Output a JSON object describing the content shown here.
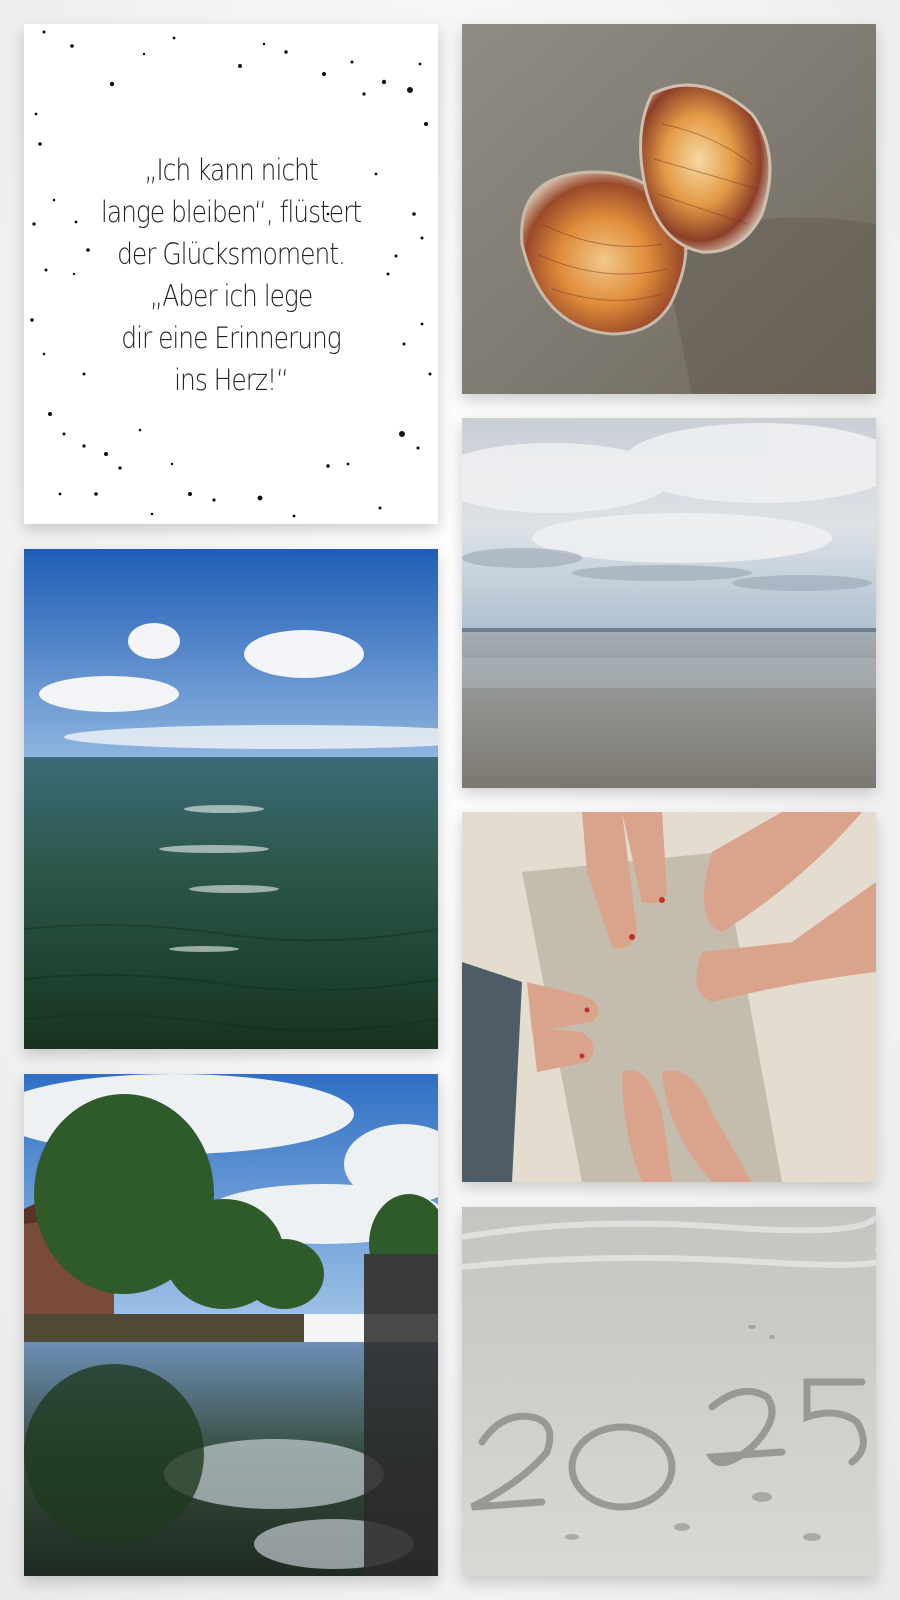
{
  "quote": {
    "lines": [
      "„Ich kann nicht",
      "lange bleiben“, flüstert",
      "der Glücksmoment.",
      "„Aber ich lege",
      "dir eine Erinnerung",
      "ins Herz!“"
    ]
  },
  "photos": {
    "shell": "cockle-shell-on-sand",
    "sea": "sea-under-blue-sky",
    "clouds": "cloudy-mudflat-beach",
    "feet": "bare-feet-in-sand",
    "canal": "tree-lined-canal-reflection",
    "sand": "2025-written-in-sand"
  },
  "sand_writing": "2025",
  "icons": {
    "smiley": "smiley-icon"
  },
  "colors": {
    "background": "#f4f4f4",
    "card": "#ffffff",
    "text": "#222222"
  }
}
